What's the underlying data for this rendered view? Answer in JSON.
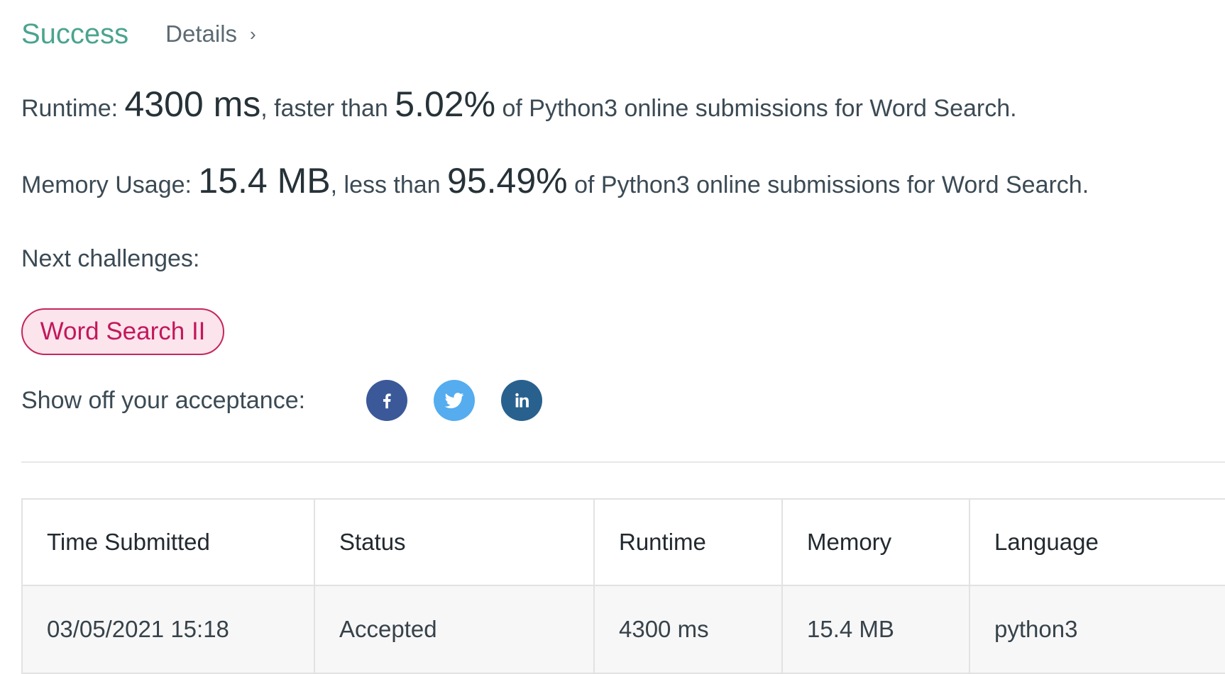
{
  "header": {
    "status": "Success",
    "details_label": "Details",
    "details_chevron": "›"
  },
  "runtime_line": {
    "prefix": "Runtime: ",
    "value": "4300 ms",
    "mid": ", faster than ",
    "percent": "5.02%",
    "suffix": " of Python3 online submissions for Word Search."
  },
  "memory_line": {
    "prefix": "Memory Usage: ",
    "value": "15.4 MB",
    "mid": ", less than ",
    "percent": "95.49%",
    "suffix": " of Python3 online submissions for Word Search."
  },
  "next": {
    "label": "Next challenges:",
    "challenges": [
      {
        "label": "Word Search II"
      }
    ]
  },
  "share": {
    "label": "Show off your acceptance:",
    "icons": [
      "facebook-icon",
      "twitter-icon",
      "linkedin-icon"
    ]
  },
  "table": {
    "headers": [
      "Time Submitted",
      "Status",
      "Runtime",
      "Memory",
      "Language"
    ],
    "rows": [
      {
        "time": "03/05/2021 15:18",
        "status": "Accepted",
        "runtime": "4300 ms",
        "memory": "15.4 MB",
        "language": "python3"
      }
    ]
  },
  "colors": {
    "success": "#4aa48f",
    "challenge_border": "#c4265c",
    "challenge_bg": "#fce4ec",
    "facebook": "#3b5998",
    "twitter": "#55acee",
    "linkedin": "#28618e",
    "accepted": "#3f9c82"
  }
}
